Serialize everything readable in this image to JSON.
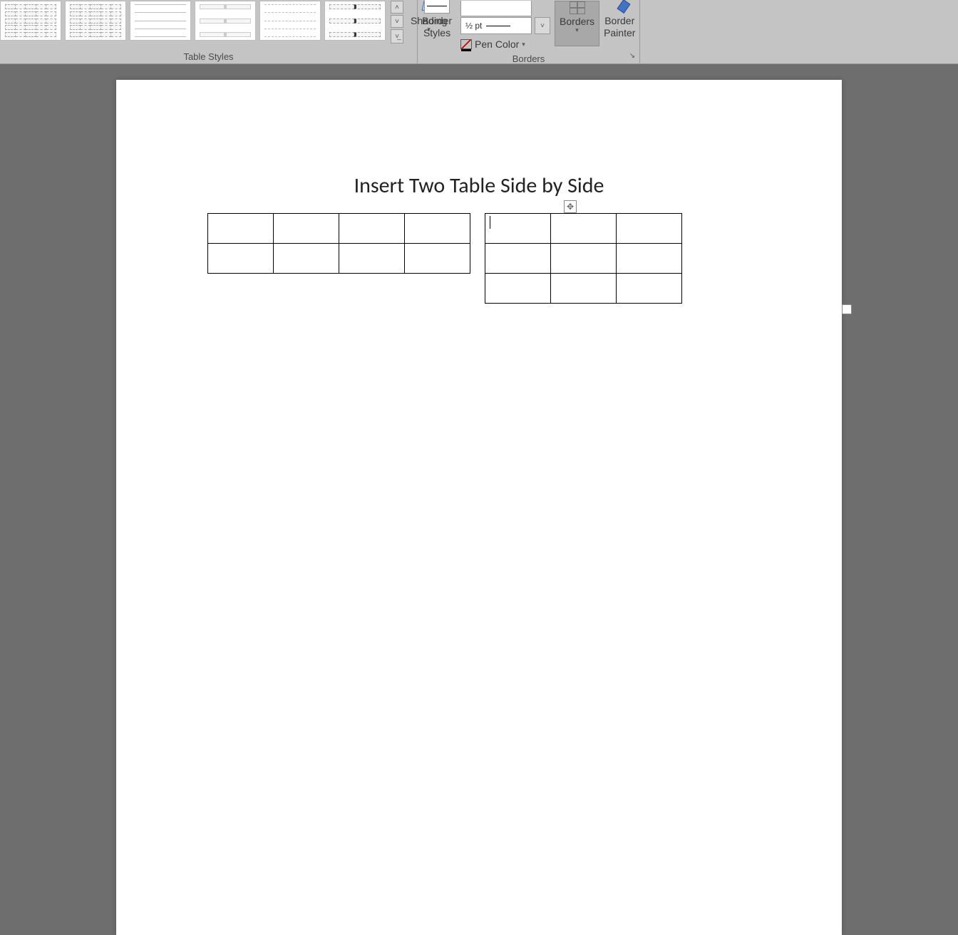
{
  "ribbon": {
    "table_styles_label": "Table Styles",
    "shading_label": "Shading",
    "border_styles_label": "Border\nStyles",
    "pen_weight_value": "½ pt",
    "pen_color_label": "Pen Color",
    "borders_label": "Borders",
    "border_painter_label": "Border\nPainter",
    "borders_group_label": "Borders"
  },
  "document": {
    "title": "Insert Two Table Side by Side",
    "left_table": {
      "rows": 2,
      "cols": 4
    },
    "right_table": {
      "rows": 3,
      "cols": 3
    }
  }
}
